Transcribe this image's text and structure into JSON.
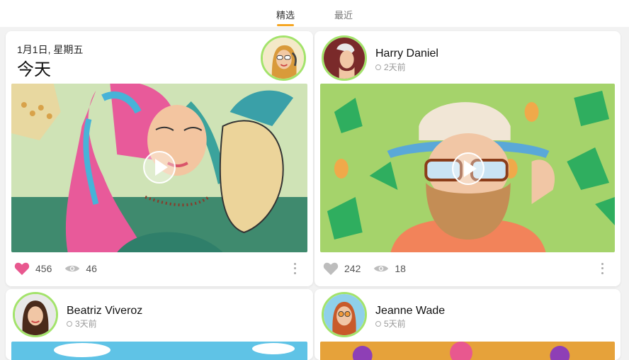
{
  "tabs": {
    "featured": "精选",
    "recent": "最近"
  },
  "today_card": {
    "date": "1月1日, 星期五",
    "title": "今天",
    "likes": "456",
    "views": "46"
  },
  "harry_card": {
    "name": "Harry Daniel",
    "time": "2天前",
    "likes": "242",
    "views": "18"
  },
  "beatriz_card": {
    "name": "Beatriz Viveroz",
    "time": "3天前"
  },
  "jeanne_card": {
    "name": "Jeanne Wade",
    "time": "5天前"
  },
  "colors": {
    "accent": "#f5a623",
    "avatar_ring": "#a3e36b",
    "liked_heart": "#e8588f",
    "unliked_heart": "#bdbdbd"
  }
}
